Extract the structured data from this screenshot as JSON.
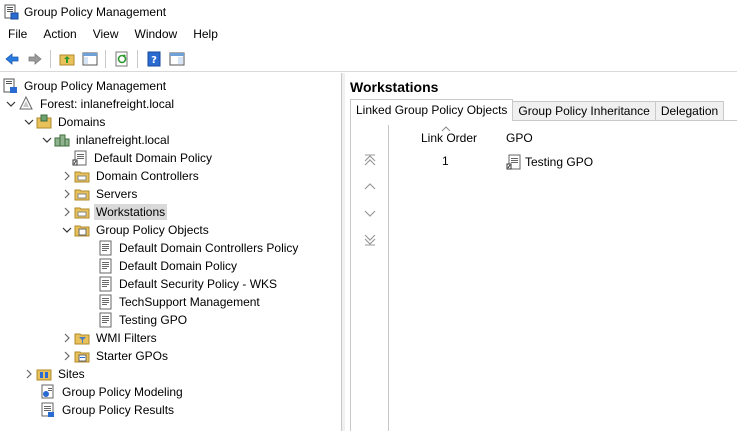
{
  "window": {
    "title": "Group Policy Management"
  },
  "menu": [
    "File",
    "Action",
    "View",
    "Window",
    "Help"
  ],
  "toolbar": {
    "buttons": [
      "back-icon",
      "forward-icon",
      "up-folder-icon",
      "show-hide-tree-icon",
      "refresh-icon",
      "help-icon",
      "properties-icon"
    ]
  },
  "tree": {
    "root": "Group Policy Management",
    "forest": "Forest: inlanefreight.local",
    "domains": "Domains",
    "domain": "inlanefreight.local",
    "default_domain_policy": "Default Domain Policy",
    "domain_controllers": "Domain Controllers",
    "servers": "Servers",
    "workstations": "Workstations",
    "gpo_container": "Group Policy Objects",
    "gpos": [
      "Default Domain Controllers Policy",
      "Default Domain Policy",
      "Default Security Policy - WKS",
      "TechSupport Management",
      "Testing GPO"
    ],
    "wmi_filters": "WMI Filters",
    "starter_gpos": "Starter GPOs",
    "sites": "Sites",
    "modeling": "Group Policy Modeling",
    "results": "Group Policy Results"
  },
  "details": {
    "title": "Workstations",
    "tabs": [
      "Linked Group Policy Objects",
      "Group Policy Inheritance",
      "Delegation"
    ],
    "columns": [
      "Link Order",
      "GPO"
    ],
    "rows": [
      {
        "link_order": "1",
        "gpo": "Testing GPO"
      }
    ]
  },
  "colors": {
    "selected_bg": "#d9d9d9",
    "folder": "#e8c15a",
    "accent_blue": "#1f6fc5"
  }
}
